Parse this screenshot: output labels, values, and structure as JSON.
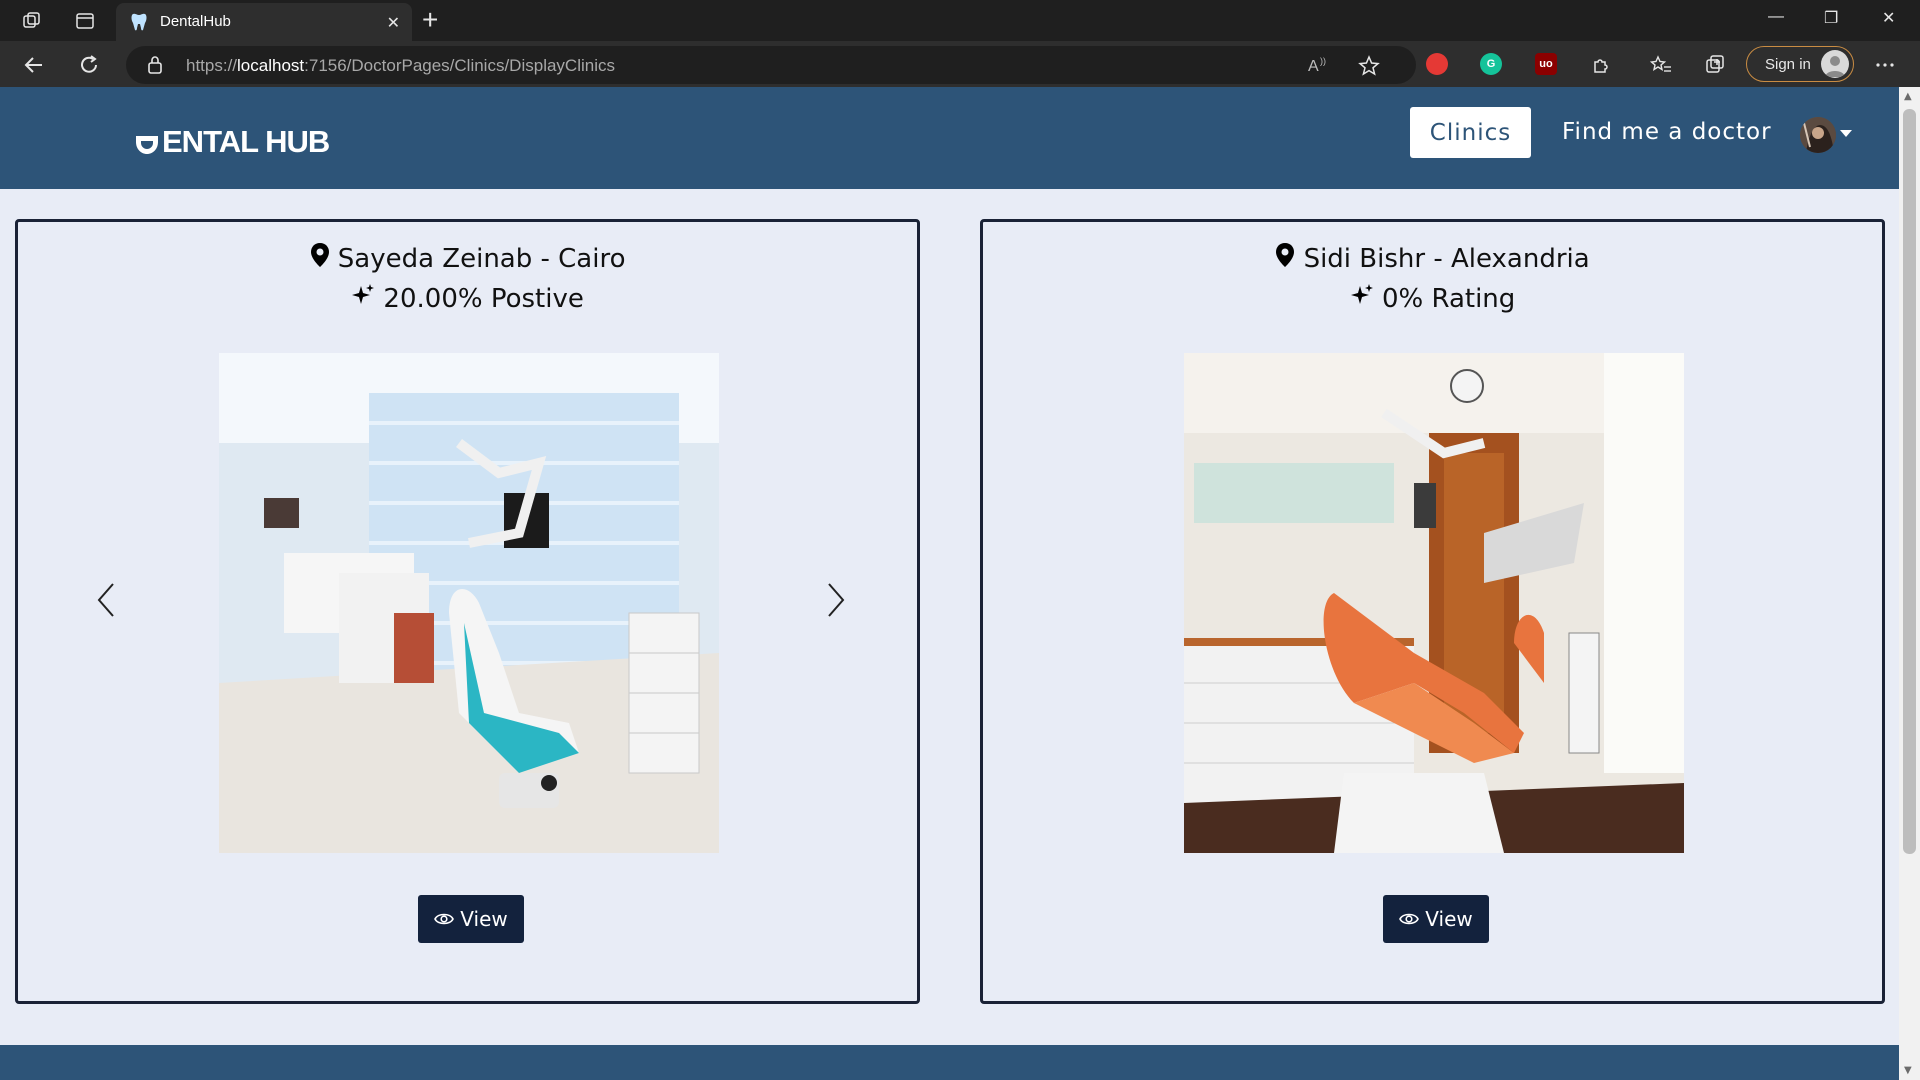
{
  "browser": {
    "tab_title": "DentalHub",
    "url_scheme": "https://",
    "url_host": "localhost",
    "url_path": ":7156/DoctorPages/Clinics/DisplayClinics",
    "signin_label": "Sign in",
    "extensions": [
      {
        "name": "adblock",
        "color": "#e53935",
        "label": ""
      },
      {
        "name": "grammarly",
        "color": "#15c39a",
        "label": "G"
      },
      {
        "name": "ublock",
        "color": "#8b0000",
        "label": "uo"
      }
    ]
  },
  "navbar": {
    "logo_text": "ENTAL HUB",
    "clinics_label": "Clinics",
    "find_doctor_label": "Find me a doctor"
  },
  "clinics": [
    {
      "location": "Sayeda Zeinab - Cairo",
      "rating": "20.00% Postive",
      "view_label": "View",
      "has_carousel": true,
      "seat_color": "#2bb6c4"
    },
    {
      "location": "Sidi Bishr - Alexandria",
      "rating": "0% Rating",
      "view_label": "View",
      "has_carousel": false,
      "seat_color": "#e8743e"
    }
  ],
  "colors": {
    "brand": "#2d5478",
    "page_bg": "#e8ecf6",
    "button_dark": "#13223d"
  }
}
